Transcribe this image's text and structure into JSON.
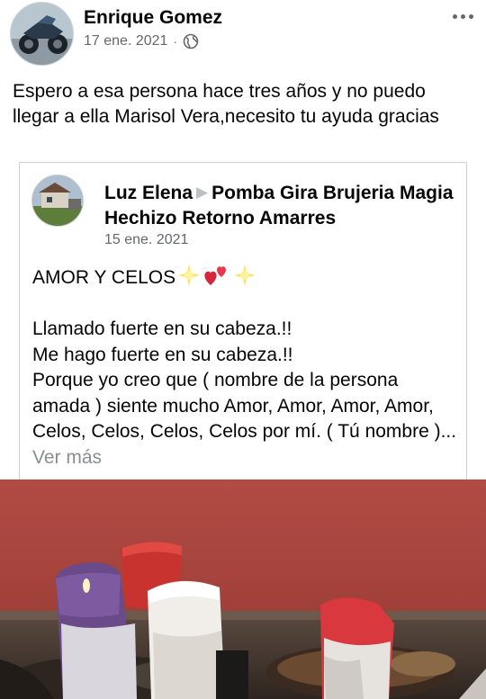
{
  "post": {
    "author": "Enrique Gomez",
    "date": "17 ene. 2021",
    "separator": "·",
    "privacy_icon": "globe-icon",
    "more_icon": "more-options-icon",
    "text": "Espero a esa persona hace tres años y no puedo llegar a ella Marisol Vera,necesito tu ayuda gracias"
  },
  "shared_post": {
    "author": "Luz Elena",
    "arrow_icon": "triangle-right-icon",
    "target_page": "Pomba Gira  Brujeria Magia Hechizo Retorno Amarres",
    "date": "15 ene. 2021",
    "heading": "AMOR Y CELOS",
    "heading_emojis": [
      "sparkle-emoji",
      "hearts-emoji",
      "sparkle-emoji"
    ],
    "line1": "Llamado fuerte en su cabeza.!!",
    "line2": "Me hago fuerte en su cabeza.!!",
    "line3": "Porque yo creo que ( nombre de la persona amada ) siente mucho Amor, Amor, Amor, Amor, Celos, Celos, Celos, Celos por mí. ( Tú nombre )...",
    "see_more": "Ver más"
  },
  "colors": {
    "text": "#050505",
    "secondary": "#65676b",
    "see_more": "#8a8d91",
    "border": "#ced0d4"
  }
}
